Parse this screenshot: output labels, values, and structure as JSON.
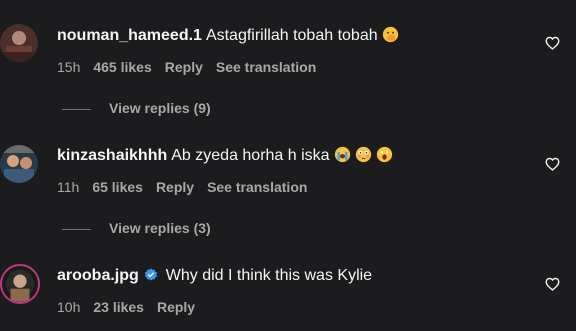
{
  "comments": [
    {
      "username": "nouman_hameed.1",
      "text": "Astagfirillah tobah tobah",
      "time": "15h",
      "likes": "465 likes",
      "reply": "Reply",
      "translate": "See translation",
      "view_replies": "View replies (9)",
      "emojis": [
        "face-with-hand-over-mouth"
      ]
    },
    {
      "username": "kinzashaikhhh",
      "text": "Ab zyeda horha h iska",
      "time": "11h",
      "likes": "65 likes",
      "reply": "Reply",
      "translate": "See translation",
      "view_replies": "View replies (3)",
      "emojis": [
        "loudly-crying-face",
        "flushed-face",
        "face-screaming"
      ]
    },
    {
      "username": "arooba.jpg",
      "text": "Why did I think this was Kylie",
      "time": "10h",
      "likes": "23 likes",
      "reply": "Reply",
      "verified": true
    }
  ],
  "colors": {
    "background": "#1c1c1e",
    "text": "#f5f5f5",
    "secondary": "#a8a8a8",
    "verified": "#3897f0"
  }
}
